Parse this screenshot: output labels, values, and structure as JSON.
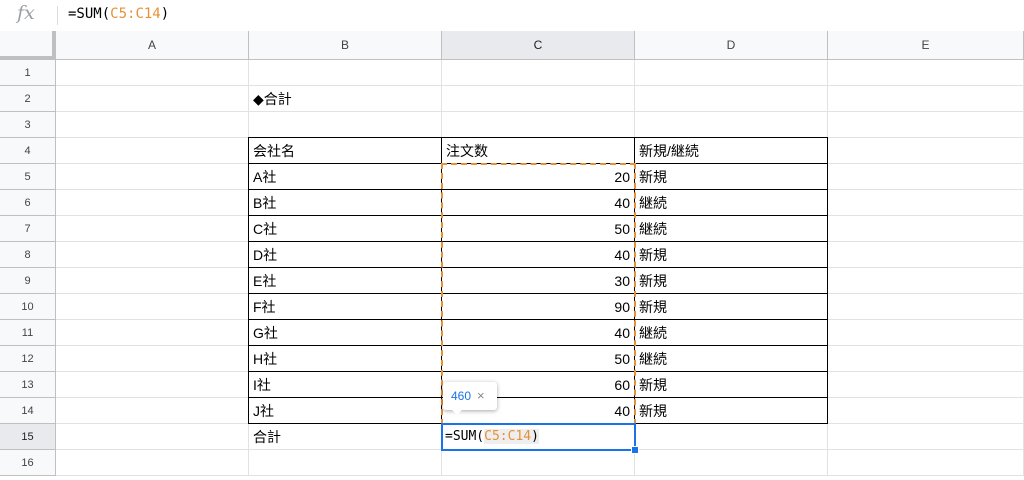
{
  "formula_bar": {
    "fx_label": "fx",
    "formula_prefix": "=SUM(",
    "formula_ref": "C5:C14",
    "formula_suffix": ")"
  },
  "columns": [
    "A",
    "B",
    "C",
    "D",
    "E"
  ],
  "rows": [
    "1",
    "2",
    "3",
    "4",
    "5",
    "6",
    "7",
    "8",
    "9",
    "10",
    "11",
    "12",
    "13",
    "14",
    "15",
    "16"
  ],
  "title": "◆合計",
  "table": {
    "headers": [
      "会社名",
      "注文数",
      "新規/継続"
    ],
    "rows": [
      {
        "company": "A社",
        "orders": "20",
        "type": "新規"
      },
      {
        "company": "B社",
        "orders": "40",
        "type": "継続"
      },
      {
        "company": "C社",
        "orders": "50",
        "type": "継続"
      },
      {
        "company": "D社",
        "orders": "40",
        "type": "新規"
      },
      {
        "company": "E社",
        "orders": "30",
        "type": "新規"
      },
      {
        "company": "F社",
        "orders": "90",
        "type": "新規"
      },
      {
        "company": "G社",
        "orders": "40",
        "type": "継続"
      },
      {
        "company": "H社",
        "orders": "50",
        "type": "継続"
      },
      {
        "company": "I社",
        "orders": "60",
        "type": "新規"
      },
      {
        "company": "J社",
        "orders": "40",
        "type": "新規"
      }
    ]
  },
  "total_label": "合計",
  "active_cell": {
    "prefix": "=SUM(",
    "ref": "C5:C14",
    "suffix": ")"
  },
  "tooltip": {
    "value": "460",
    "close": "×"
  },
  "colors": {
    "accent": "#1a73e8",
    "range_ref": "#e69138"
  }
}
